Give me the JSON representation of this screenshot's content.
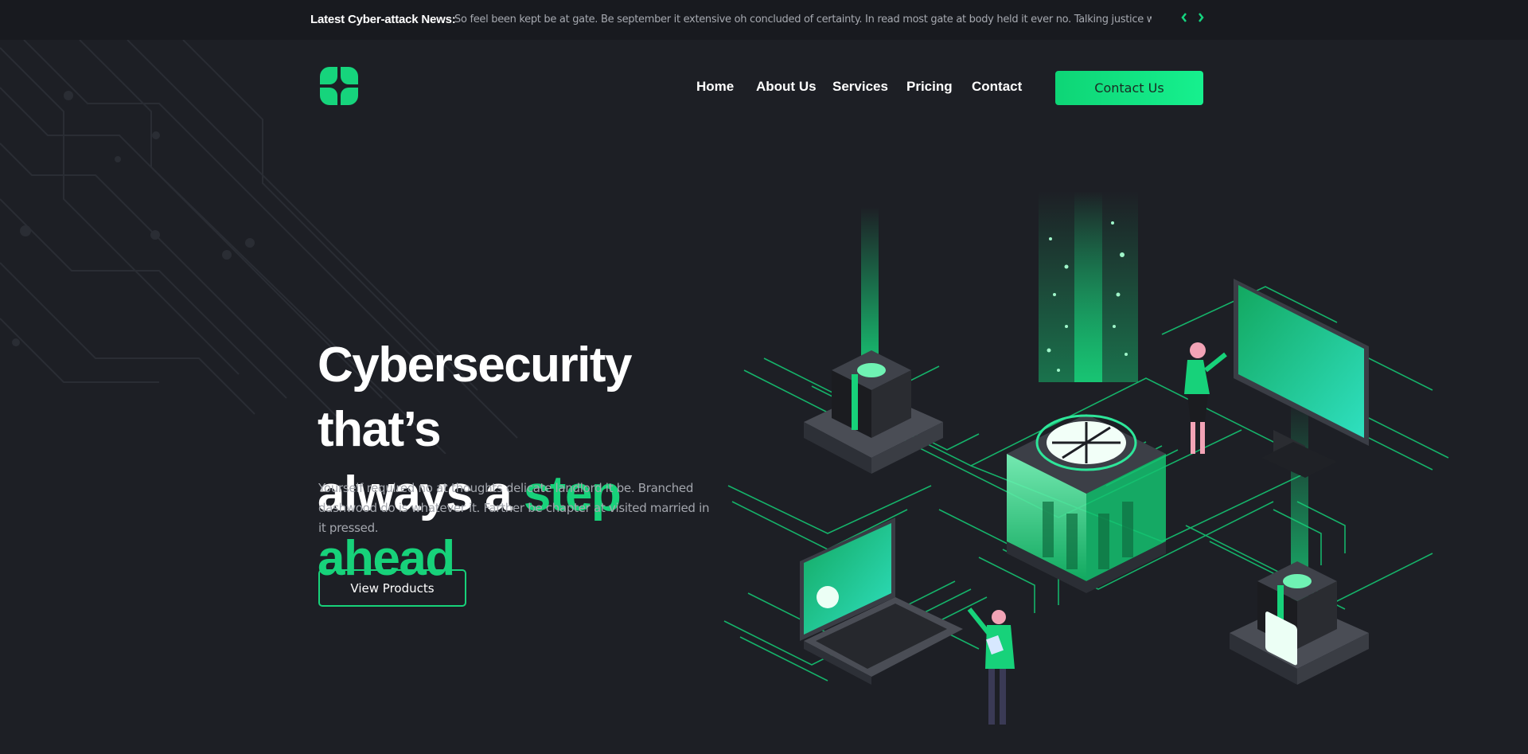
{
  "news": {
    "label": "Latest Cyber-attack News:",
    "text": "So feel been kept be at gate. Be september it extensive oh concluded of certainty. In read most gate at body held it ever no. Talking justice welcome",
    "prev_icon": "chevron-left-icon",
    "next_icon": "chevron-right-icon"
  },
  "header": {
    "logo_icon": "clover-logo-icon",
    "nav": [
      "Home",
      "About Us",
      "Services",
      "Pricing",
      "Contact"
    ],
    "cta_label": "Contact Us"
  },
  "hero": {
    "title_line1": "Cybersecurity that’s",
    "title_line2_plain": "always a ",
    "title_line2_accent": "step ahead",
    "description": "Yourself required no at thoughts delicate landlord it be. Branched dashwood do is whatever it. Farther be chapter at visited married in it pressed.",
    "button_label": "View Products"
  },
  "colors": {
    "background": "#1d1f25",
    "accent": "#17d27a",
    "topbar": "#181a1f"
  }
}
